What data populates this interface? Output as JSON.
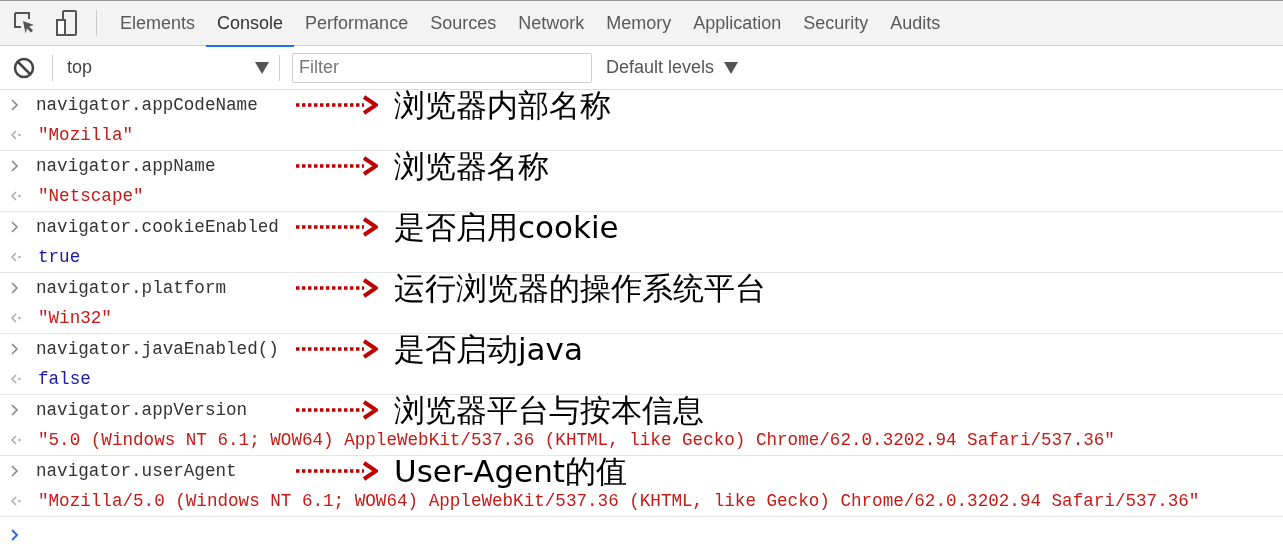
{
  "tabs": [
    {
      "label": "Elements",
      "selected": false
    },
    {
      "label": "Console",
      "selected": true
    },
    {
      "label": "Performance",
      "selected": false
    },
    {
      "label": "Sources",
      "selected": false
    },
    {
      "label": "Network",
      "selected": false
    },
    {
      "label": "Memory",
      "selected": false
    },
    {
      "label": "Application",
      "selected": false
    },
    {
      "label": "Security",
      "selected": false
    },
    {
      "label": "Audits",
      "selected": false
    }
  ],
  "toolbar": {
    "context": "top",
    "filter": {
      "placeholder": "Filter"
    },
    "levels": "Default levels"
  },
  "entries": [
    {
      "command": "navigator.appCodeName",
      "result": "\"Mozilla\"",
      "kind": "string",
      "note": "浏览器内部名称"
    },
    {
      "command": "navigator.appName",
      "result": "\"Netscape\"",
      "kind": "string",
      "note": "浏览器名称"
    },
    {
      "command": "navigator.cookieEnabled",
      "result": "true",
      "kind": "keyword",
      "note": "是否启用cookie"
    },
    {
      "command": "navigator.platform",
      "result": "\"Win32\"",
      "kind": "string",
      "note": "运行浏览器的操作系统平台"
    },
    {
      "command": "navigator.javaEnabled()",
      "result": "false",
      "kind": "keyword",
      "note": "是否启动java"
    },
    {
      "command": "navigator.appVersion",
      "result": "\"5.0 (Windows NT 6.1; WOW64) AppleWebKit/537.36 (KHTML, like Gecko) Chrome/62.0.3202.94 Safari/537.36\"",
      "kind": "string",
      "note": "浏览器平台与按本信息"
    },
    {
      "command": "navigator.userAgent",
      "result": "\"Mozilla/5.0 (Windows NT 6.1; WOW64) AppleWebKit/537.36 (KHTML, like Gecko) Chrome/62.0.3202.94 Safari/537.36\"",
      "kind": "string",
      "note": "User-Agent的值"
    }
  ]
}
